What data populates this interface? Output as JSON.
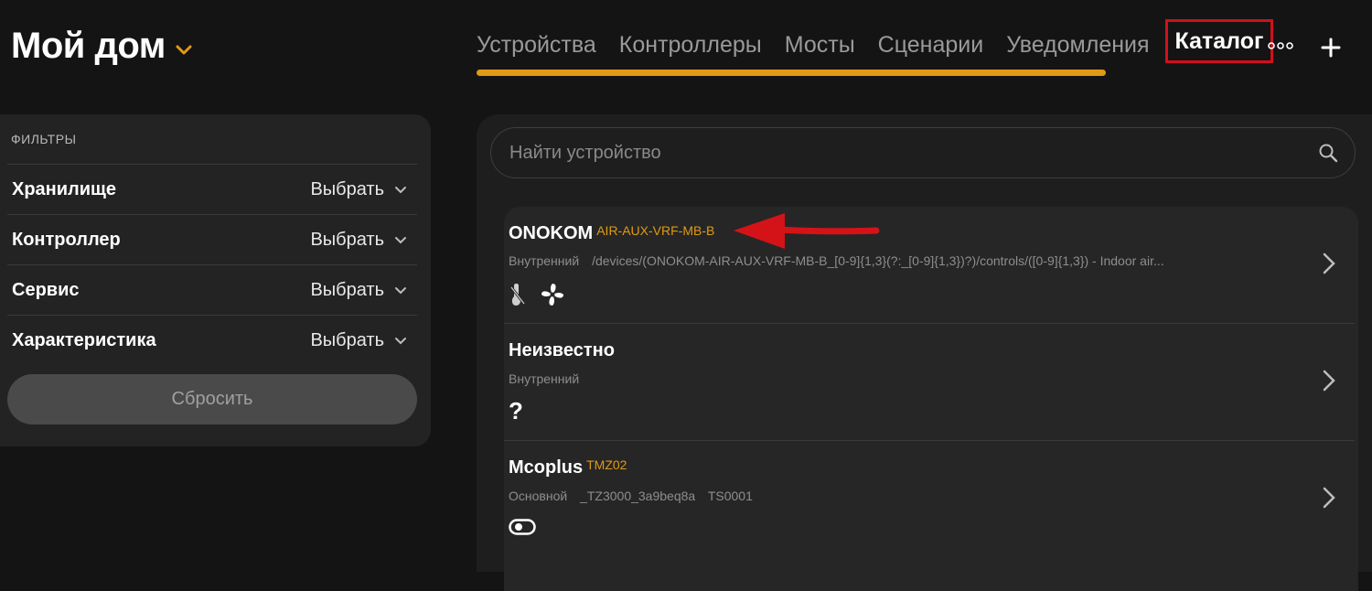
{
  "header": {
    "home_title": "Мой дом",
    "tabs": [
      {
        "label": "Устройства",
        "active": true
      },
      {
        "label": "Контроллеры"
      },
      {
        "label": "Мосты"
      },
      {
        "label": "Сценарии"
      },
      {
        "label": "Уведомления"
      },
      {
        "label": "Каталог",
        "highlighted": true
      }
    ],
    "accent_color": "#e09a14",
    "highlight_color": "#d0101c"
  },
  "filters": {
    "heading": "ФИЛЬТРЫ",
    "rows": [
      {
        "label": "Хранилище",
        "value": "Выбрать"
      },
      {
        "label": "Контроллер",
        "value": "Выбрать"
      },
      {
        "label": "Сервис",
        "value": "Выбрать"
      },
      {
        "label": "Характеристика",
        "value": "Выбрать"
      }
    ],
    "reset_label": "Сбросить"
  },
  "search": {
    "placeholder": "Найти устройство"
  },
  "devices": [
    {
      "name": "ONOKOM",
      "model": "AIR-AUX-VRF-MB-B",
      "meta": [
        "Внутренний",
        "/devices/(ONOKOM-AIR-AUX-VRF-MB-B_[0-9]{1,3}(?:_[0-9]{1,3})?)/controls/([0-9]{1,3}) - Indoor air..."
      ],
      "icons": [
        "thermometer-icon",
        "fan-icon"
      ]
    },
    {
      "name": "Неизвестно",
      "model": "",
      "meta": [
        "Внутренний"
      ],
      "icons": [
        "question-icon"
      ],
      "icon_text": "?"
    },
    {
      "name": "Mcoplus",
      "model": "TMZ02",
      "meta": [
        "Основной",
        "_TZ3000_3a9beq8a",
        "TS0001"
      ],
      "icons": [
        "toggle-icon"
      ]
    }
  ]
}
